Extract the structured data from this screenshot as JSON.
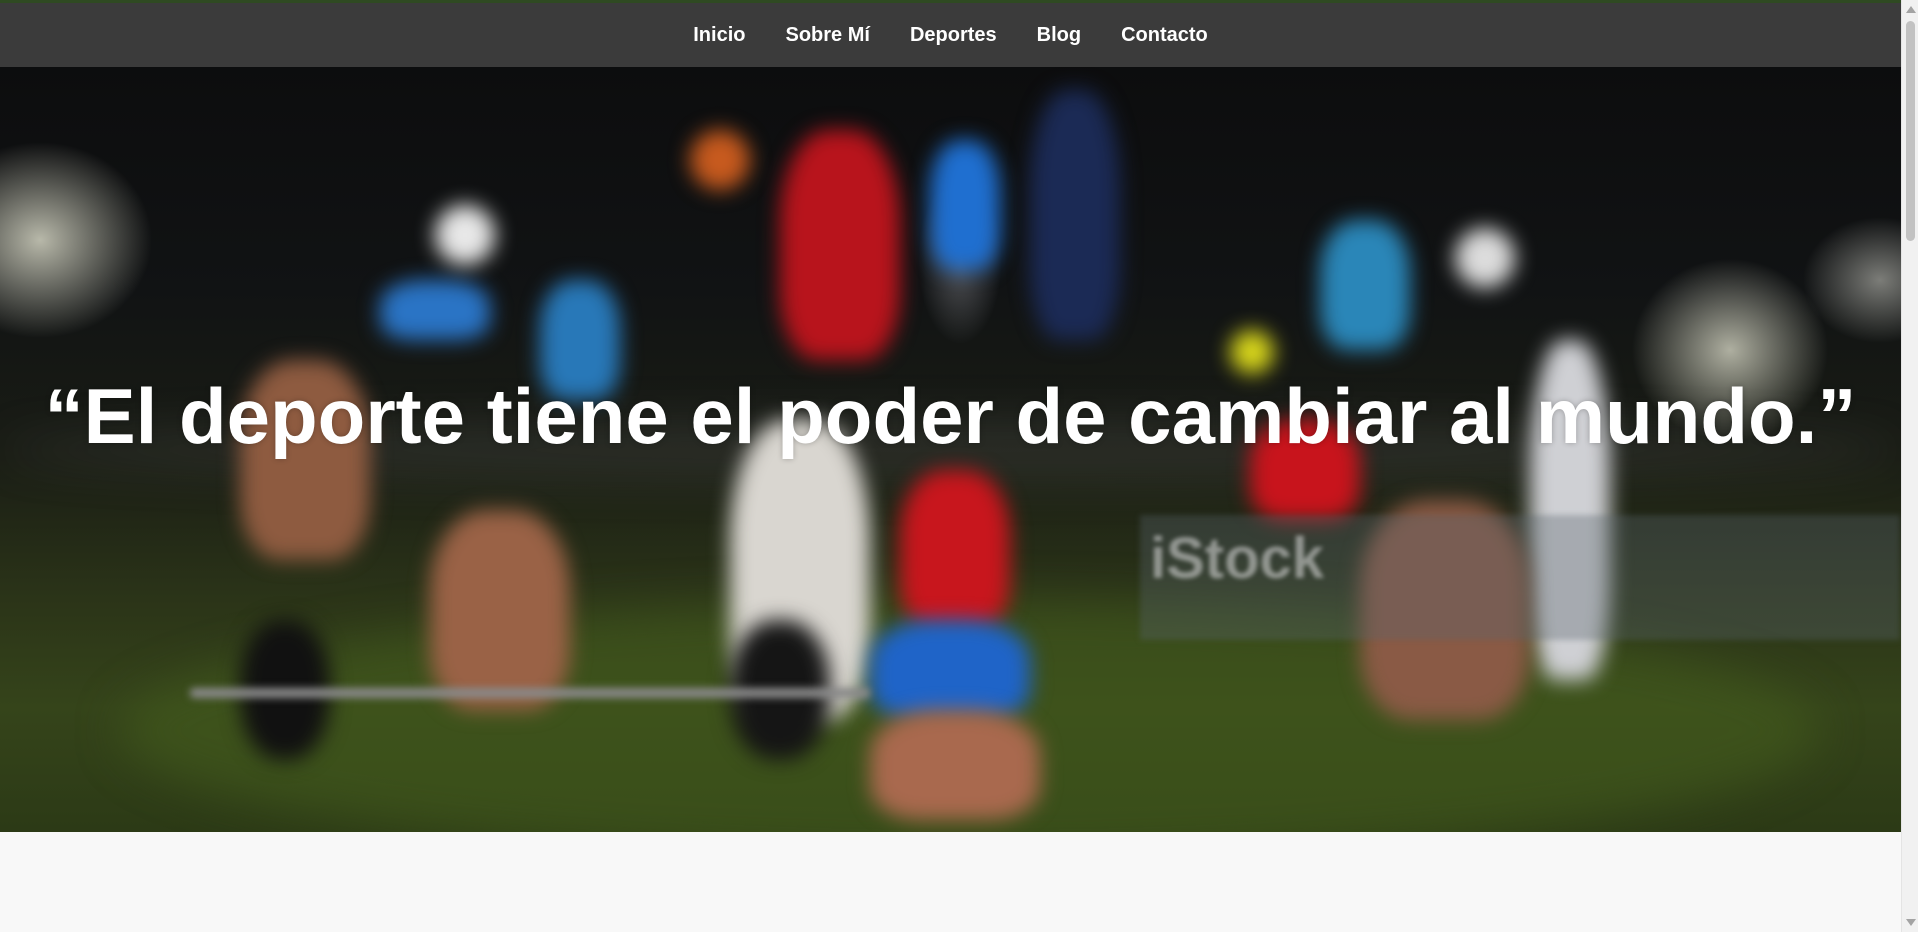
{
  "nav": {
    "items": [
      {
        "label": "Inicio"
      },
      {
        "label": "Sobre Mí"
      },
      {
        "label": "Deportes"
      },
      {
        "label": "Blog"
      },
      {
        "label": "Contacto"
      }
    ]
  },
  "hero": {
    "quote": "“El deporte tiene el poder de cambiar al mundo.”",
    "watermark": "iStock"
  },
  "colors": {
    "nav_background": "#464646",
    "nav_text": "#ffffff",
    "page_background": "#f8f8f8",
    "top_border": "#2f4a22"
  }
}
